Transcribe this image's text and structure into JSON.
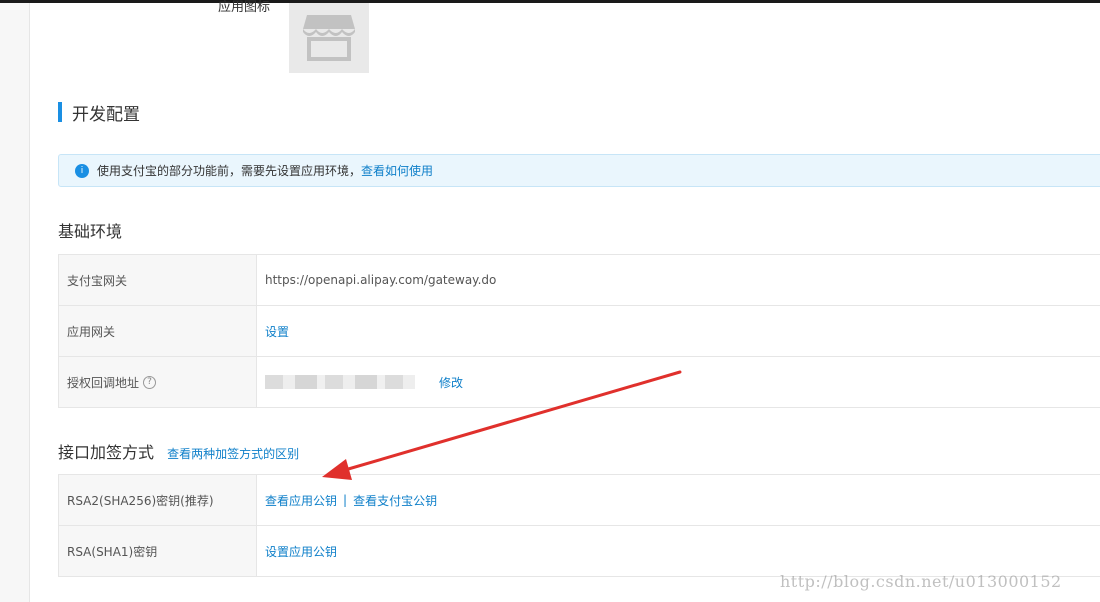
{
  "app_icon": {
    "label": "应用图标",
    "icon": "store-icon"
  },
  "dev_config": {
    "title": "开发配置",
    "notice": {
      "icon_text": "i",
      "message": "使用支付宝的部分功能前，需要先设置应用环境，",
      "link": "查看如何使用"
    }
  },
  "basic_env": {
    "title": "基础环境",
    "rows": [
      {
        "label": "支付宝网关",
        "value": "https://openapi.alipay.com/gateway.do"
      },
      {
        "label": "应用网关",
        "link": "设置"
      },
      {
        "label": "授权回调地址",
        "help_icon": "?",
        "link": "修改"
      }
    ]
  },
  "sign_method": {
    "title": "接口加签方式",
    "link": "查看两种加签方式的区别",
    "rows": [
      {
        "label": "RSA2(SHA256)密钥(推荐)",
        "link1": "查看应用公钥",
        "separator": "|",
        "link2": "查看支付宝公钥"
      },
      {
        "label": "RSA(SHA1)密钥",
        "link": "设置应用公钥"
      }
    ]
  },
  "watermark": "http://blog.csdn.net/u013000152",
  "colors": {
    "accent": "#1a8fe3",
    "link": "#0e7fc9",
    "annotation": "#e0302c"
  }
}
